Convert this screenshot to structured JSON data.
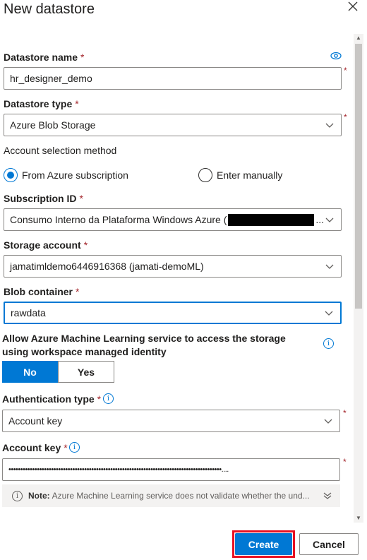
{
  "panel": {
    "title": "New datastore",
    "close_icon": "close-icon"
  },
  "form": {
    "datastore_name": {
      "label": "Datastore name",
      "required_mark": "*",
      "value": "hr_designer_demo"
    },
    "datastore_type": {
      "label": "Datastore type",
      "required_mark": "*",
      "value": "Azure Blob Storage"
    },
    "account_selection": {
      "label": "Account selection method",
      "options": [
        {
          "label": "From Azure subscription",
          "selected": true
        },
        {
          "label": "Enter manually",
          "selected": false
        }
      ]
    },
    "subscription_id": {
      "label": "Subscription ID",
      "required_mark": "*",
      "value": "Consumo Interno da Plataforma Windows Azure (",
      "value_suffix": "..."
    },
    "storage_account": {
      "label": "Storage account",
      "required_mark": "*",
      "value": "jamatimldemo6446916368 (jamati-demoML)"
    },
    "blob_container": {
      "label": "Blob container",
      "required_mark": "*",
      "value": "rawdata"
    },
    "managed_identity": {
      "label": "Allow Azure Machine Learning service to access the storage using workspace managed identity",
      "options": [
        "No",
        "Yes"
      ],
      "selected": "No"
    },
    "authentication_type": {
      "label": "Authentication type",
      "required_mark": "*",
      "value": "Account key"
    },
    "account_key": {
      "label": "Account key",
      "required_mark": "*",
      "value": "••••••••••••••••••••••••••••••••••••••••••••••••••••••••••••••••••••••••••••••••••••••••••...."
    },
    "note": {
      "prefix": "Note:",
      "text": "Azure Machine Learning service does not validate whether the und..."
    }
  },
  "footer": {
    "create_label": "Create",
    "cancel_label": "Cancel"
  },
  "colors": {
    "accent": "#0078d4",
    "required": "#a4262c",
    "highlight": "#e81123"
  }
}
